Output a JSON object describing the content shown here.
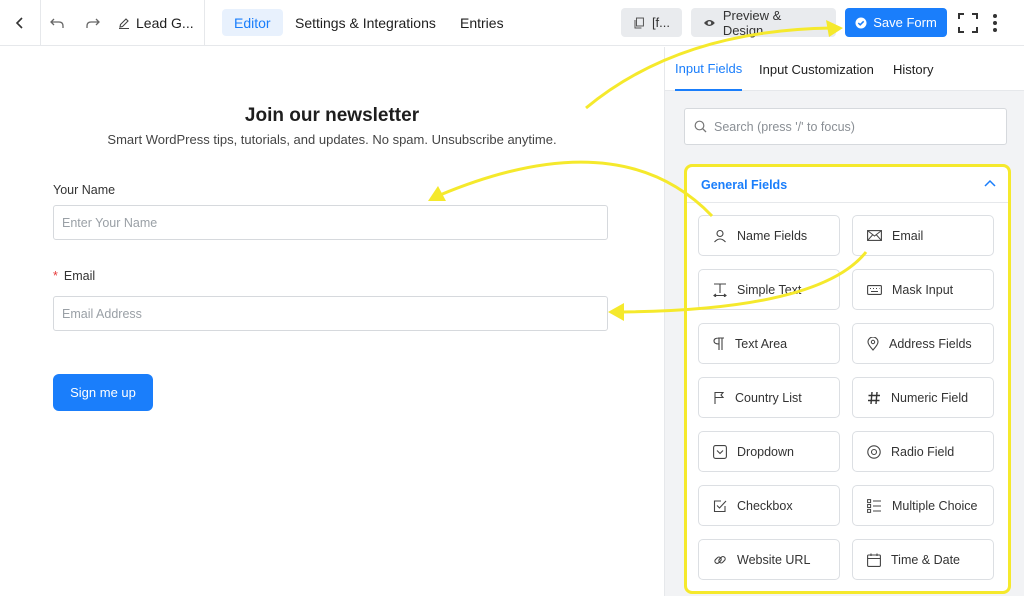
{
  "topbar": {
    "doc_title": "Lead G...",
    "tabs": [
      {
        "label": "Editor",
        "active": true
      },
      {
        "label": "Settings & Integrations",
        "active": false
      },
      {
        "label": "Entries",
        "active": false
      }
    ],
    "shortcode_label": "[f...",
    "preview_label": "Preview & Design",
    "save_label": "Save Form"
  },
  "form": {
    "title": "Join our newsletter",
    "subtitle": "Smart WordPress tips, tutorials, and updates. No spam. Unsubscribe anytime.",
    "name_label": "Your Name",
    "name_placeholder": "Enter Your Name",
    "email_required_mark": "*",
    "email_label": "Email",
    "email_placeholder": "Email Address",
    "submit_label": "Sign me up"
  },
  "sidebar": {
    "tabs": [
      {
        "label": "Input Fields",
        "active": true
      },
      {
        "label": "Input Customization",
        "active": false
      },
      {
        "label": "History",
        "active": false
      }
    ],
    "search_placeholder": "Search (press '/' to focus)",
    "section_title": "General Fields",
    "fields": [
      {
        "label": "Name Fields",
        "icon": "user-icon"
      },
      {
        "label": "Email",
        "icon": "envelope-icon"
      },
      {
        "label": "Simple Text",
        "icon": "text-cursor-icon"
      },
      {
        "label": "Mask Input",
        "icon": "keyboard-icon"
      },
      {
        "label": "Text Area",
        "icon": "paragraph-icon"
      },
      {
        "label": "Address Fields",
        "icon": "map-pin-icon"
      },
      {
        "label": "Country List",
        "icon": "flag-icon"
      },
      {
        "label": "Numeric Field",
        "icon": "hash-icon"
      },
      {
        "label": "Dropdown",
        "icon": "dropdown-icon"
      },
      {
        "label": "Radio Field",
        "icon": "radio-icon"
      },
      {
        "label": "Checkbox",
        "icon": "checkbox-icon"
      },
      {
        "label": "Multiple Choice",
        "icon": "list-icon"
      },
      {
        "label": "Website URL",
        "icon": "link-icon"
      },
      {
        "label": "Time & Date",
        "icon": "calendar-icon"
      }
    ]
  },
  "colors": {
    "accent": "#1a7efb",
    "highlight": "#f5e92c",
    "required": "#e63a3a"
  }
}
